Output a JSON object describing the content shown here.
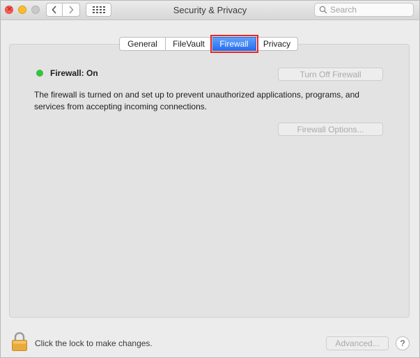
{
  "window": {
    "title": "Security & Privacy",
    "search_placeholder": "Search",
    "search_value": ""
  },
  "tabs": [
    {
      "label": "General",
      "active": false
    },
    {
      "label": "FileVault",
      "active": false
    },
    {
      "label": "Firewall",
      "active": true
    },
    {
      "label": "Privacy",
      "active": false
    }
  ],
  "firewall": {
    "status_label": "Firewall: On",
    "status_color": "#37c23e",
    "turn_off_label": "Turn Off Firewall",
    "description": "The firewall is turned on and set up to prevent unauthorized applications, programs, and services from accepting incoming connections.",
    "options_label": "Firewall Options..."
  },
  "footer": {
    "lock_text": "Click the lock to make changes.",
    "advanced_label": "Advanced...",
    "help_label": "?"
  },
  "colors": {
    "highlight_outline": "#e8261e",
    "active_tab": "#2a6ef0"
  }
}
